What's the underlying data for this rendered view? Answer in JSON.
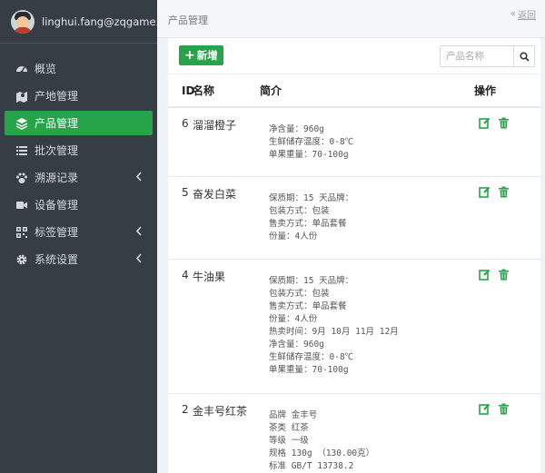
{
  "user": {
    "email": "linghui.fang@zqgame.com"
  },
  "sidebar": {
    "items": [
      {
        "label": "概览",
        "icon": "dashboard-icon",
        "active": false,
        "has_submenu": false
      },
      {
        "label": "产地管理",
        "icon": "map-icon",
        "active": false,
        "has_submenu": false
      },
      {
        "label": "产品管理",
        "icon": "layers-icon",
        "active": true,
        "has_submenu": false
      },
      {
        "label": "批次管理",
        "icon": "list-icon",
        "active": false,
        "has_submenu": false
      },
      {
        "label": "溯源记录",
        "icon": "paw-icon",
        "active": false,
        "has_submenu": true
      },
      {
        "label": "设备管理",
        "icon": "video-camera-icon",
        "active": false,
        "has_submenu": false
      },
      {
        "label": "标签管理",
        "icon": "qrcode-icon",
        "active": false,
        "has_submenu": true
      },
      {
        "label": "系统设置",
        "icon": "gear-icon",
        "active": false,
        "has_submenu": true
      }
    ]
  },
  "header": {
    "title": "产品管理",
    "back_label": "返回"
  },
  "toolbar": {
    "add_label": "新增",
    "search_placeholder": "产品名称"
  },
  "table": {
    "columns": {
      "id": "ID",
      "name": "名称",
      "desc": "简介",
      "actions": "操作"
    },
    "rows": [
      {
        "id": "6",
        "name": "溜溜橙子",
        "desc": [
          "净含量：960g",
          "生鲜储存温度：0-8℃",
          "单果重量：70-100g"
        ]
      },
      {
        "id": "5",
        "name": "奋发白菜",
        "desc": [
          "保质期：15 天品牌：",
          "包装方式：包装",
          "售卖方式：单品套餐",
          "份量：4人份"
        ]
      },
      {
        "id": "4",
        "name": "牛油果",
        "desc": [
          "保质期：15 天品牌：",
          "包装方式：包装",
          "售卖方式：单品套餐",
          "份量：4人份",
          "热卖时间：9月 10月 11月 12月",
          "净含量：960g",
          "生鲜储存温度：0-8℃",
          "单果重量：70-100g"
        ]
      },
      {
        "id": "2",
        "name": "金丰号红茶",
        "desc": [
          "品牌 金丰号",
          "茶类 红茶",
          "等级 一级",
          "规格 130g （130.00克）",
          "标准 GB/T 13738.2"
        ]
      }
    ]
  },
  "colors": {
    "sidebar_bg": "#363d45",
    "accent_green": "#27a349"
  }
}
